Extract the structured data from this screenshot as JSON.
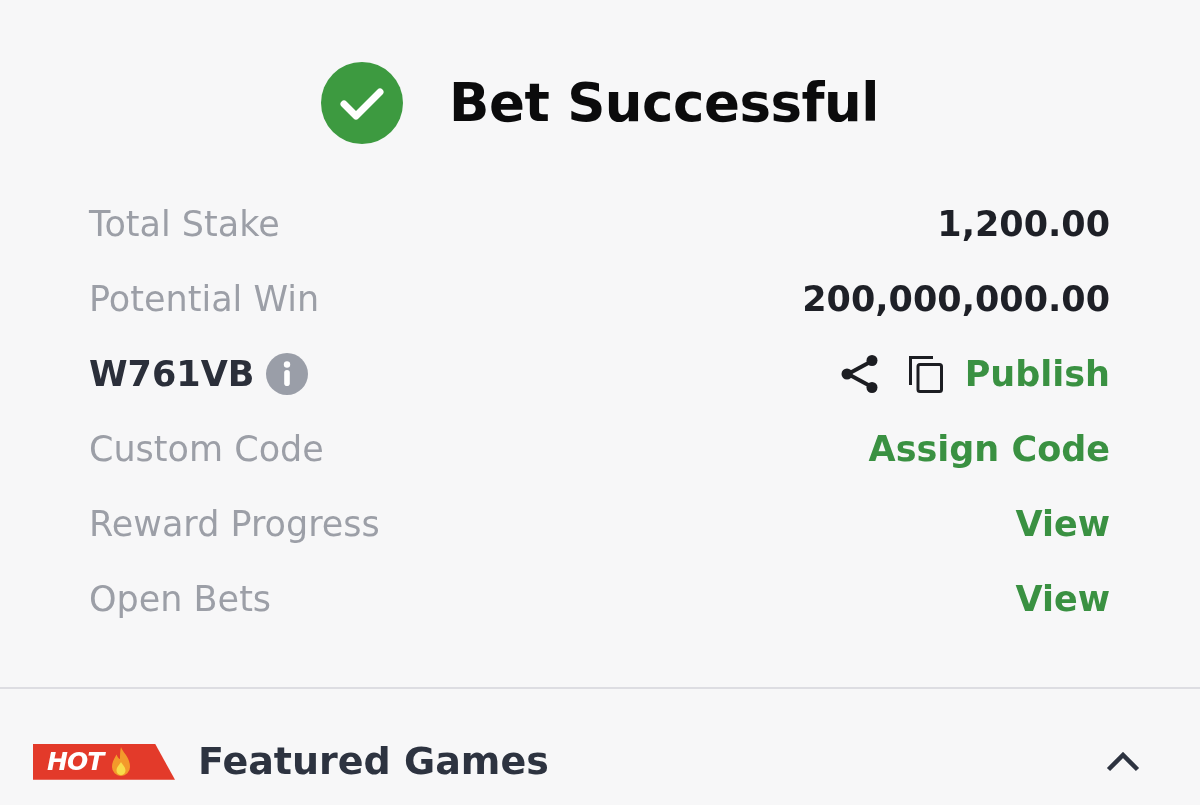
{
  "header": {
    "title": "Bet Successful"
  },
  "summary_rows": [
    {
      "kind": "amount",
      "label": "Total Stake",
      "value": "1,200.00"
    },
    {
      "kind": "amount",
      "label": "Potential Win",
      "value": "200,000,000.00"
    },
    {
      "kind": "code",
      "code": "W761VB",
      "action": "Publish"
    },
    {
      "kind": "link",
      "label": "Custom Code",
      "action": "Assign Code"
    },
    {
      "kind": "link",
      "label": "Reward Progress",
      "action": "View"
    },
    {
      "kind": "link",
      "label": "Open Bets",
      "action": "View"
    }
  ],
  "featured": {
    "badge": "HOT",
    "title": "Featured Games",
    "expanded": true
  }
}
